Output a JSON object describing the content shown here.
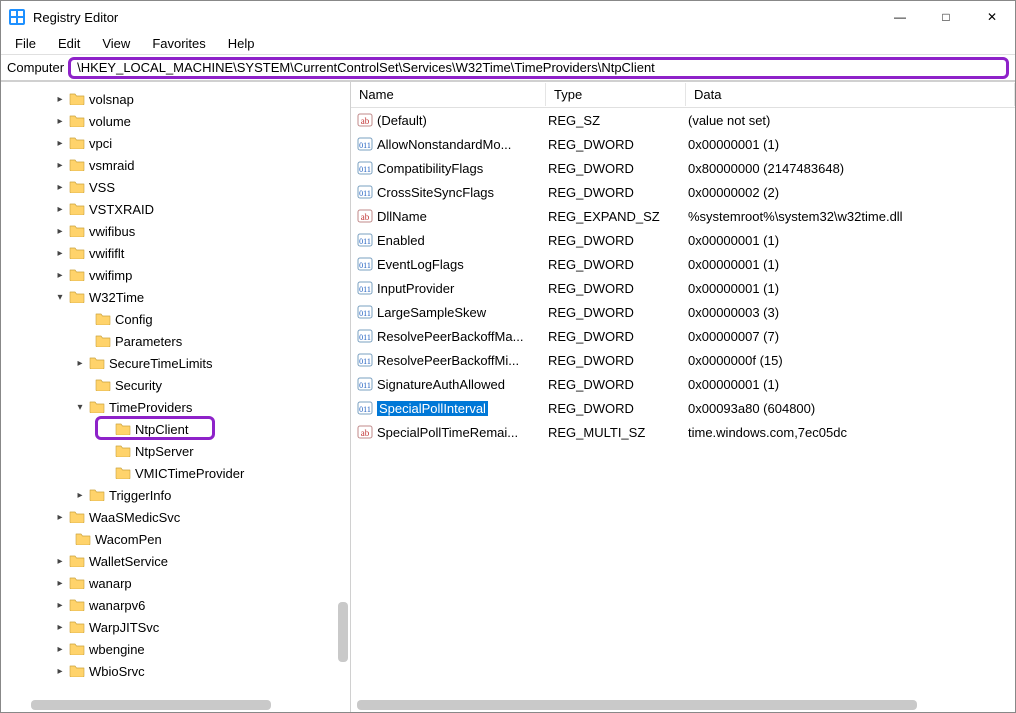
{
  "window": {
    "title": "Registry Editor"
  },
  "menu": {
    "file": "File",
    "edit": "Edit",
    "view": "View",
    "favorites": "Favorites",
    "help": "Help"
  },
  "address": {
    "label": "Computer",
    "path": "\\HKEY_LOCAL_MACHINE\\SYSTEM\\CurrentControlSet\\Services\\W32Time\\TimeProviders\\NtpClient"
  },
  "tree": {
    "nodes": [
      {
        "indent": 52,
        "twisty": ">",
        "label": "volsnap"
      },
      {
        "indent": 52,
        "twisty": ">",
        "label": "volume"
      },
      {
        "indent": 52,
        "twisty": ">",
        "label": "vpci"
      },
      {
        "indent": 52,
        "twisty": ">",
        "label": "vsmraid"
      },
      {
        "indent": 52,
        "twisty": ">",
        "label": "VSS"
      },
      {
        "indent": 52,
        "twisty": ">",
        "label": "VSTXRAID"
      },
      {
        "indent": 52,
        "twisty": ">",
        "label": "vwifibus"
      },
      {
        "indent": 52,
        "twisty": ">",
        "label": "vwififlt"
      },
      {
        "indent": 52,
        "twisty": ">",
        "label": "vwifimp"
      },
      {
        "indent": 52,
        "twisty": "v",
        "label": "W32Time"
      },
      {
        "indent": 78,
        "twisty": "",
        "label": "Config"
      },
      {
        "indent": 78,
        "twisty": "",
        "label": "Parameters"
      },
      {
        "indent": 72,
        "twisty": ">",
        "label": "SecureTimeLimits"
      },
      {
        "indent": 78,
        "twisty": "",
        "label": "Security"
      },
      {
        "indent": 72,
        "twisty": "v",
        "label": "TimeProviders"
      },
      {
        "indent": 98,
        "twisty": "",
        "label": "NtpClient",
        "highlighted": true
      },
      {
        "indent": 98,
        "twisty": "",
        "label": "NtpServer"
      },
      {
        "indent": 98,
        "twisty": "",
        "label": "VMICTimeProvider"
      },
      {
        "indent": 72,
        "twisty": ">",
        "label": "TriggerInfo"
      },
      {
        "indent": 52,
        "twisty": ">",
        "label": "WaaSMedicSvc"
      },
      {
        "indent": 58,
        "twisty": "",
        "label": "WacomPen"
      },
      {
        "indent": 52,
        "twisty": ">",
        "label": "WalletService"
      },
      {
        "indent": 52,
        "twisty": ">",
        "label": "wanarp"
      },
      {
        "indent": 52,
        "twisty": ">",
        "label": "wanarpv6"
      },
      {
        "indent": 52,
        "twisty": ">",
        "label": "WarpJITSvc"
      },
      {
        "indent": 52,
        "twisty": ">",
        "label": "wbengine"
      },
      {
        "indent": 52,
        "twisty": ">",
        "label": "WbioSrvc"
      }
    ]
  },
  "list": {
    "columns": {
      "name": "Name",
      "type": "Type",
      "data": "Data"
    },
    "rows": [
      {
        "icon": "str",
        "name": "(Default)",
        "type": "REG_SZ",
        "data": "(value not set)"
      },
      {
        "icon": "bin",
        "name": "AllowNonstandardMo...",
        "type": "REG_DWORD",
        "data": "0x00000001 (1)"
      },
      {
        "icon": "bin",
        "name": "CompatibilityFlags",
        "type": "REG_DWORD",
        "data": "0x80000000 (2147483648)"
      },
      {
        "icon": "bin",
        "name": "CrossSiteSyncFlags",
        "type": "REG_DWORD",
        "data": "0x00000002 (2)"
      },
      {
        "icon": "str",
        "name": "DllName",
        "type": "REG_EXPAND_SZ",
        "data": "%systemroot%\\system32\\w32time.dll"
      },
      {
        "icon": "bin",
        "name": "Enabled",
        "type": "REG_DWORD",
        "data": "0x00000001 (1)"
      },
      {
        "icon": "bin",
        "name": "EventLogFlags",
        "type": "REG_DWORD",
        "data": "0x00000001 (1)"
      },
      {
        "icon": "bin",
        "name": "InputProvider",
        "type": "REG_DWORD",
        "data": "0x00000001 (1)"
      },
      {
        "icon": "bin",
        "name": "LargeSampleSkew",
        "type": "REG_DWORD",
        "data": "0x00000003 (3)"
      },
      {
        "icon": "bin",
        "name": "ResolvePeerBackoffMa...",
        "type": "REG_DWORD",
        "data": "0x00000007 (7)"
      },
      {
        "icon": "bin",
        "name": "ResolvePeerBackoffMi...",
        "type": "REG_DWORD",
        "data": "0x0000000f (15)"
      },
      {
        "icon": "bin",
        "name": "SignatureAuthAllowed",
        "type": "REG_DWORD",
        "data": "0x00000001 (1)"
      },
      {
        "icon": "bin",
        "name": "SpecialPollInterval",
        "type": "REG_DWORD",
        "data": "0x00093a80 (604800)",
        "selected": true
      },
      {
        "icon": "str",
        "name": "SpecialPollTimeRemai...",
        "type": "REG_MULTI_SZ",
        "data": "time.windows.com,7ec05dc"
      }
    ]
  }
}
